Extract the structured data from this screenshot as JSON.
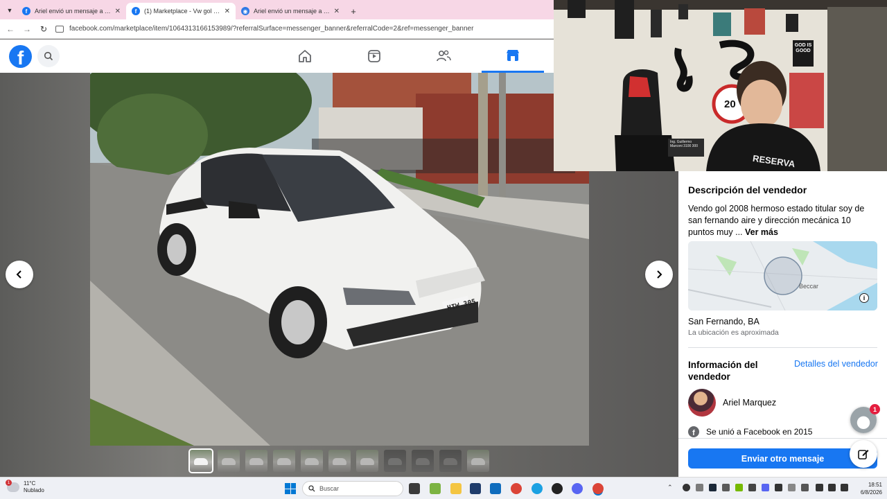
{
  "browser": {
    "tabs": [
      {
        "label": "Ariel envió un mensaje a Ariel",
        "favicon": "f",
        "active": false
      },
      {
        "label": "(1) Marketplace - Vw gol 2008",
        "favicon": "f",
        "active": true
      },
      {
        "label": "Ariel envió un mensaje a Ariel",
        "favicon": "chrome",
        "active": false
      }
    ],
    "new_tab": "+",
    "url": "facebook.com/marketplace/item/1064313166153989/?referralSurface=messenger_banner&referralCode=2&ref=messenger_banner"
  },
  "facebook": {
    "logo_letter": "f",
    "nav_active": "marketplace"
  },
  "listing": {
    "photo_count": 11,
    "selected_photo_index": 0,
    "plate_text": "HIW 305"
  },
  "seller_panel": {
    "description_title": "Descripción del vendedor",
    "description_text": "Vendo gol 2008 hermoso estado titular  soy de san fernando  aire y dirección mecánica 10 puntos muy ...",
    "see_more": "Ver más",
    "map_label": "Beccar",
    "location": "San Fernando, BA",
    "location_note": "La ubicación es aproximada",
    "seller_info_title": "Información del vendedor",
    "seller_details_link": "Detalles del vendedor",
    "seller_name": "Ariel Marquez",
    "joined": "Se unió a Facebook en 2015",
    "send_button": "Enviar otro mensaje",
    "chat_badge": "1"
  },
  "webcam": {
    "poster_text": "GOD IS GOOD",
    "shirt_text": "RESERVA",
    "sign_speed": "20",
    "street_sign": "Ing. Guillermo Marconi 3100  300"
  },
  "taskbar": {
    "weather_temp": "11°C",
    "weather_desc": "Nublado",
    "weather_badge": "1",
    "search_placeholder": "Buscar",
    "time": "18:51",
    "date": "6/8/2026"
  },
  "colors": {
    "facebook_blue": "#1877f2",
    "tab_strip": "#f7d7e6"
  }
}
